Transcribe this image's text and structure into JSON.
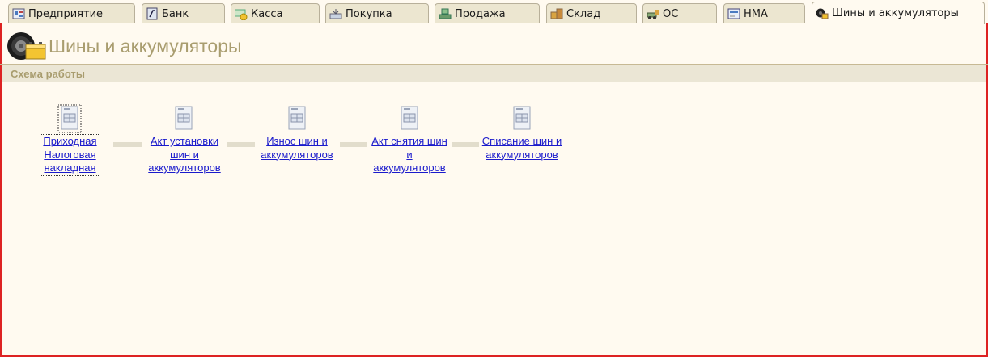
{
  "tabs": [
    {
      "label": "Предприятие",
      "icon": "enterprise-icon"
    },
    {
      "label": "Банк",
      "icon": "bank-icon"
    },
    {
      "label": "Касса",
      "icon": "cash-icon"
    },
    {
      "label": "Покупка",
      "icon": "purchase-icon"
    },
    {
      "label": "Продажа",
      "icon": "sale-icon"
    },
    {
      "label": "Склад",
      "icon": "warehouse-icon"
    },
    {
      "label": "ОС",
      "icon": "fixed-assets-icon"
    },
    {
      "label": "НМА",
      "icon": "intangible-assets-icon"
    },
    {
      "label": "Шины и аккумуляторы",
      "icon": "tires-batteries-icon",
      "active": true
    }
  ],
  "page": {
    "title": "Шины и аккумуляторы",
    "section_title": "Схема работы"
  },
  "workflow": [
    {
      "label_lines": [
        "Приходная",
        "Налоговая",
        "накладная"
      ]
    },
    {
      "label_lines": [
        "Акт установки",
        "шин и",
        "аккумуляторов"
      ]
    },
    {
      "label_lines": [
        "Износ шин и",
        "аккумуляторов"
      ]
    },
    {
      "label_lines": [
        "Акт снятия шин",
        "и",
        "аккумуляторов"
      ]
    },
    {
      "label_lines": [
        "Списание шин и",
        "аккумуляторов"
      ]
    }
  ],
  "colors": {
    "background": "#fffaf0",
    "frame_border": "#dd2222",
    "link": "#1a1acc",
    "title": "#a99d6f"
  }
}
